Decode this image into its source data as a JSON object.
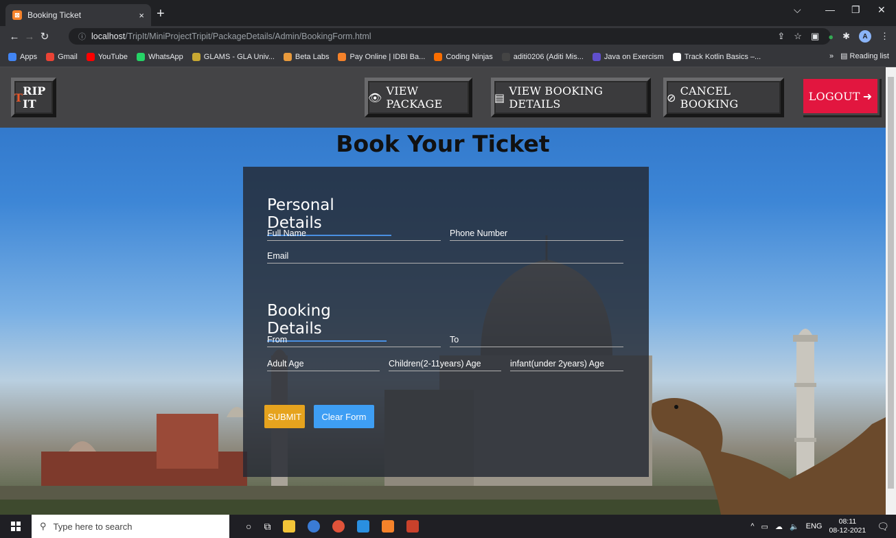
{
  "browser": {
    "tab_title": "Booking Ticket",
    "tab_close": "×",
    "new_tab": "+",
    "window_controls": [
      "⌵",
      "—",
      "❐",
      "✕"
    ],
    "url_host": "localhost",
    "url_path": "/TripIt/MiniProjectTripit/PackageDetails/Admin/BookingForm.html",
    "avatar_letter": "A"
  },
  "bookmarks": {
    "items": [
      {
        "label": "Apps",
        "color": "#4285f4"
      },
      {
        "label": "Gmail",
        "color": "#ea4335"
      },
      {
        "label": "YouTube",
        "color": "#ff0000"
      },
      {
        "label": "WhatsApp",
        "color": "#25d366"
      },
      {
        "label": "GLAMS - GLA Univ...",
        "color": "#c8a832"
      },
      {
        "label": "Beta Labs",
        "color": "#e89a3c"
      },
      {
        "label": "Pay Online | IDBI Ba...",
        "color": "#f5822a"
      },
      {
        "label": "Coding Ninjas",
        "color": "#f96d00"
      },
      {
        "label": "aditi0206 (Aditi Mis...",
        "color": "#444444"
      },
      {
        "label": "Java on Exercism",
        "color": "#604fcd"
      },
      {
        "label": "Track Kotlin Basics –...",
        "color": "#ffffff"
      }
    ],
    "overflow": "»",
    "reading_list": "Reading list"
  },
  "navbar": {
    "brand_first": "T",
    "brand_rest": "RIP IT",
    "view_package": "VIEW PACKAGE",
    "view_booking": "VIEW BOOKING DETAILS",
    "cancel_booking": "CANCEL BOOKING",
    "logout": "LOGOUT",
    "colors": {
      "logout": "#e2163f",
      "brand_accent": "#e8572a"
    }
  },
  "page": {
    "heading": "Book Your Ticket"
  },
  "form": {
    "personal_title": "Personal Details",
    "full_name": "Full Name",
    "phone": "Phone Number",
    "email": "Email",
    "booking_title": "Booking Details",
    "from": "From",
    "to": "To",
    "adult_age": "Adult Age",
    "children_age": "Children(2-11years) Age",
    "infant_age": "infant(under 2years) Age",
    "submit": "SUBMIT",
    "clear": "Clear Form",
    "colors": {
      "submit": "#e6a31e",
      "clear": "#3e9ef4",
      "underline": "#4a90e2"
    }
  },
  "taskbar": {
    "search_placeholder": "Type here to search",
    "language": "ENG",
    "time": "08:11",
    "date": "08-12-2021"
  }
}
